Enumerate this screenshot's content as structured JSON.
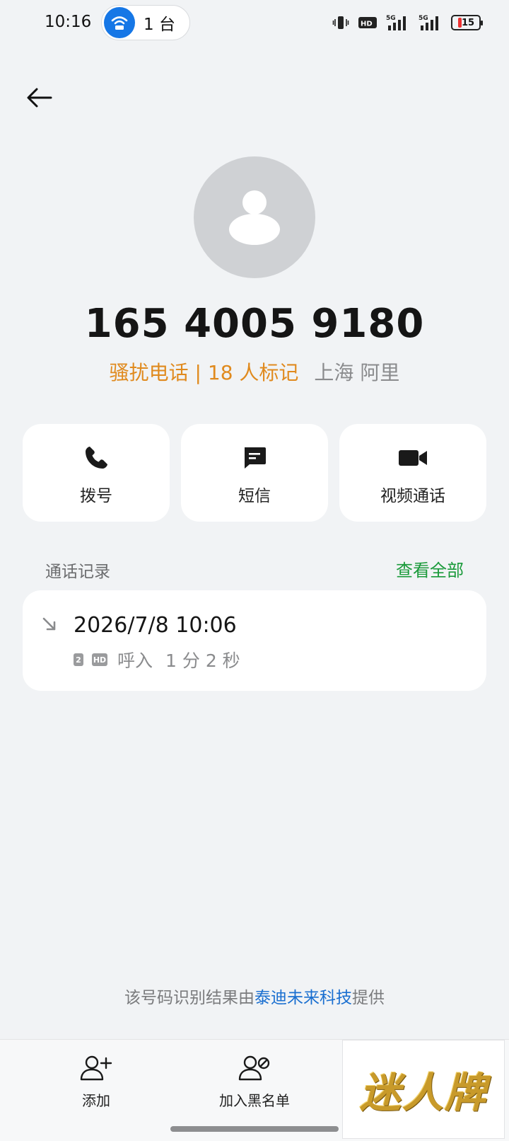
{
  "status_bar": {
    "time": "10:16",
    "hotspot_count": "1 台",
    "network_1": "5G",
    "network_2": "5G",
    "battery": "15",
    "icons": [
      "vibrate-icon",
      "hd-voice-icon",
      "signal-5g-icon",
      "signal-5g-icon",
      "battery-icon"
    ]
  },
  "contact": {
    "phone_number": "165 4005 9180",
    "tag": "骚扰电话 | 18 人标记",
    "location": "上海 阿里"
  },
  "actions": [
    {
      "label": "拨号",
      "icon": "phone-icon"
    },
    {
      "label": "短信",
      "icon": "message-icon"
    },
    {
      "label": "视频通话",
      "icon": "video-camera-icon"
    }
  ],
  "call_log": {
    "title": "通话记录",
    "see_all": "查看全部",
    "entries": [
      {
        "datetime": "2026/7/8 10:06",
        "sim": "2",
        "hd": "HD",
        "type": "呼入",
        "duration": "1 分 2 秒",
        "direction_icon": "incoming-arrow-icon"
      }
    ]
  },
  "provider": {
    "prefix": "该号码识别结果由",
    "link": "泰迪未来科技",
    "suffix": "提供"
  },
  "bottom_bar": {
    "add_label": "添加",
    "blacklist_label": "加入黑名单",
    "brand": "迷人牌"
  },
  "colors": {
    "accent_green": "#1a9a3a",
    "tag_orange": "#e08a1e",
    "link_blue": "#1a6fd0",
    "hotspot_blue": "#1677e6"
  }
}
